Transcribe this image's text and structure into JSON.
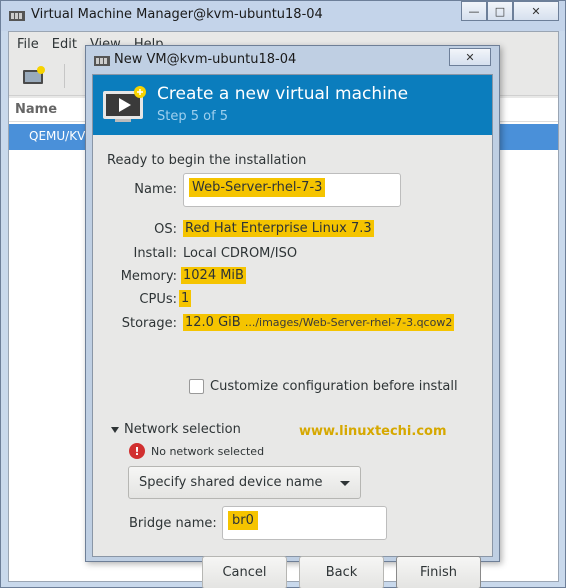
{
  "outer_window": {
    "title": "Virtual Machine Manager@kvm-ubuntu18-04",
    "menu": [
      "File",
      "Edit",
      "View",
      "Help"
    ],
    "list_header": "Name",
    "selected_row": "QEMU/KVM"
  },
  "dialog": {
    "title": "New VM@kvm-ubuntu18-04",
    "banner_title": "Create a new virtual machine",
    "banner_step": "Step 5 of 5",
    "ready_text": "Ready to begin the installation",
    "labels": {
      "name": "Name:",
      "os": "OS:",
      "install": "Install:",
      "memory": "Memory:",
      "cpus": "CPUs:",
      "storage": "Storage:"
    },
    "values": {
      "name": "Web-Server-rhel-7-3",
      "os": "Red Hat Enterprise Linux 7.3",
      "install": "Local CDROM/ISO",
      "memory": "1024 MiB",
      "cpus": "1",
      "storage_size": "12.0 GiB",
      "storage_path": ".../images/Web-Server-rhel-7-3.qcow2"
    },
    "customize_label": "Customize configuration before install",
    "customize_checked": false,
    "network": {
      "section_label": "Network selection",
      "warning": "No network selected",
      "device_option": "Specify shared device name",
      "bridge_label": "Bridge name:",
      "bridge_value": "br0"
    },
    "watermark": "www.linuxtechi.com",
    "buttons": {
      "cancel": "Cancel",
      "back": "Back",
      "finish": "Finish"
    }
  },
  "colors": {
    "banner": "#0b7dbd",
    "highlight": "#f5c400",
    "selection": "#4a90d9",
    "watermark": "#d6a800"
  },
  "icons": [
    "app-icon",
    "new-vm-icon",
    "monitor-play-icon",
    "warning-icon",
    "chevron-down-icon",
    "close-icon"
  ]
}
